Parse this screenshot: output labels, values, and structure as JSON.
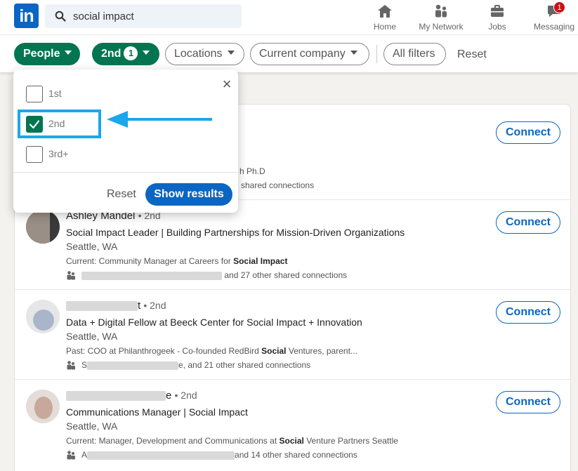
{
  "nav": {
    "logo": "in",
    "search_value": "social impact",
    "items": [
      {
        "label": "Home",
        "icon": "home-icon"
      },
      {
        "label": "My Network",
        "icon": "network-icon"
      },
      {
        "label": "Jobs",
        "icon": "jobs-icon"
      },
      {
        "label": "Messaging",
        "icon": "messaging-icon",
        "badge": "1"
      }
    ]
  },
  "filters": {
    "people": "People",
    "second": "2nd",
    "second_count": "1",
    "locations": "Locations",
    "current_company": "Current company",
    "all_filters": "All filters",
    "reset": "Reset"
  },
  "dropdown": {
    "options": [
      {
        "label": "1st",
        "checked": false
      },
      {
        "label": "2nd",
        "checked": true
      },
      {
        "label": "3rd+",
        "checked": false
      }
    ],
    "reset": "Reset",
    "show_results": "Show results",
    "close": "×"
  },
  "results": [
    {
      "name_tail": "",
      "degree": "",
      "headline": "",
      "location": "",
      "meta_suffix": "h Ph.D",
      "shared_tail": "shared connections",
      "connect": "Connect"
    },
    {
      "name": "Ashley Mandel",
      "degree": "• 2nd",
      "headline": "Social Impact Leader | Building Partnerships for Mission-Driven Organizations",
      "location": "Seattle, WA",
      "meta_prefix": "Current: Community Manager at Careers for ",
      "meta_bold": "Social Impact",
      "shared_tail": "and 27 other shared connections",
      "connect": "Connect"
    },
    {
      "name_tail": "t",
      "degree": "• 2nd",
      "headline": "Data + Digital Fellow at Beeck Center for Social Impact + Innovation",
      "location": "Seattle, WA",
      "meta_prefix": "Past: COO at Philanthrogeek - Co-founded RedBird ",
      "meta_bold": "Social",
      "meta_suffix": " Ventures, parent...",
      "shared_head": "S",
      "shared_tail": "e, and 21 other shared connections",
      "connect": "Connect"
    },
    {
      "name_tail": "e",
      "degree": "• 2nd",
      "headline": "Communications Manager | Social Impact",
      "location": "Seattle, WA",
      "meta_prefix": "Current: Manager, Development and Communications at ",
      "meta_bold": "Social",
      "meta_suffix": " Venture Partners Seattle",
      "shared_head": "A",
      "shared_tail": "and 14 other shared connections",
      "connect": "Connect"
    }
  ],
  "colors": {
    "brand_blue": "#0a66c2",
    "active_green": "#01754f",
    "highlight_cyan": "#1aa7ec"
  }
}
